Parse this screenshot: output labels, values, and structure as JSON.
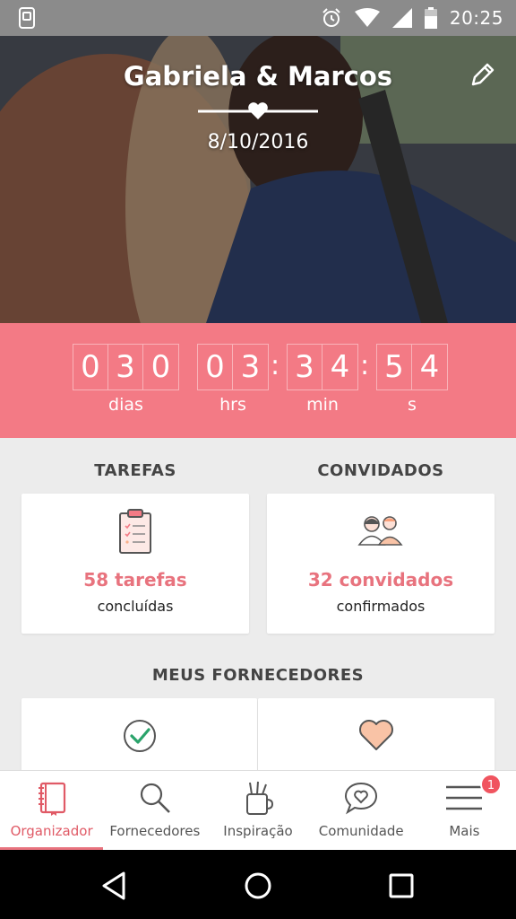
{
  "status_bar": {
    "time": "20:25",
    "icons": [
      "screen-mirror-icon",
      "alarm-icon",
      "wifi-icon",
      "signal-icon",
      "battery-icon"
    ]
  },
  "hero": {
    "couple_name": "Gabriela & Marcos",
    "wedding_date": "8/10/2016",
    "edit_icon": "pencil-icon"
  },
  "countdown": {
    "days_digits": [
      "0",
      "3",
      "0"
    ],
    "hours_digits": [
      "0",
      "3"
    ],
    "minutes_digits": [
      "3",
      "4"
    ],
    "seconds_digits": [
      "5",
      "4"
    ],
    "separator": ":",
    "labels": {
      "days": "dias",
      "hours": "hrs",
      "minutes": "min",
      "seconds": "s"
    }
  },
  "tasks": {
    "title": "TAREFAS",
    "value": "58 tarefas",
    "caption": "concluídas",
    "icon": "clipboard-checklist-icon"
  },
  "guests": {
    "title": "CONVIDADOS",
    "value": "32 convidados",
    "caption": "confirmados",
    "icon": "couple-guests-icon"
  },
  "vendors": {
    "title": "MEUS FORNECEDORES",
    "items": [
      {
        "icon": "check-circle-icon"
      },
      {
        "icon": "heart-icon"
      }
    ]
  },
  "bottom_nav": {
    "items": [
      {
        "label": "Organizador",
        "icon": "notebook-icon",
        "active": true
      },
      {
        "label": "Fornecedores",
        "icon": "search-icon",
        "active": false
      },
      {
        "label": "Inspiração",
        "icon": "jar-pencils-icon",
        "active": false
      },
      {
        "label": "Comunidade",
        "icon": "chat-heart-icon",
        "active": false
      },
      {
        "label": "Mais",
        "icon": "menu-icon",
        "active": false,
        "badge": "1"
      }
    ]
  },
  "colors": {
    "accent": "#f37a85",
    "accent_text": "#e8737e",
    "background": "#ececec",
    "status_bar": "#8b8b8b"
  }
}
